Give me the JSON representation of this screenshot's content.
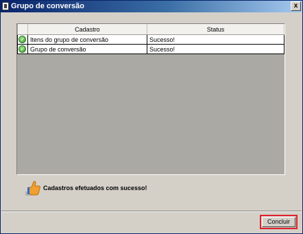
{
  "window": {
    "title": "Grupo de conversão",
    "close_label": "x"
  },
  "grid": {
    "columns": [
      "Cadastro",
      "Status"
    ],
    "rows": [
      {
        "cadastro": "Itens do grupo de conversão",
        "status": "Sucesso!",
        "icon": "check-icon"
      },
      {
        "cadastro": "Grupo de conversão",
        "status": "Sucesso!",
        "icon": "check-icon"
      }
    ]
  },
  "message": {
    "text": "Cadastros efetuados com sucesso!",
    "icon": "thumbs-up-icon"
  },
  "footer": {
    "concluir_label": "Concluir",
    "highlight_color": "#e0202b"
  }
}
